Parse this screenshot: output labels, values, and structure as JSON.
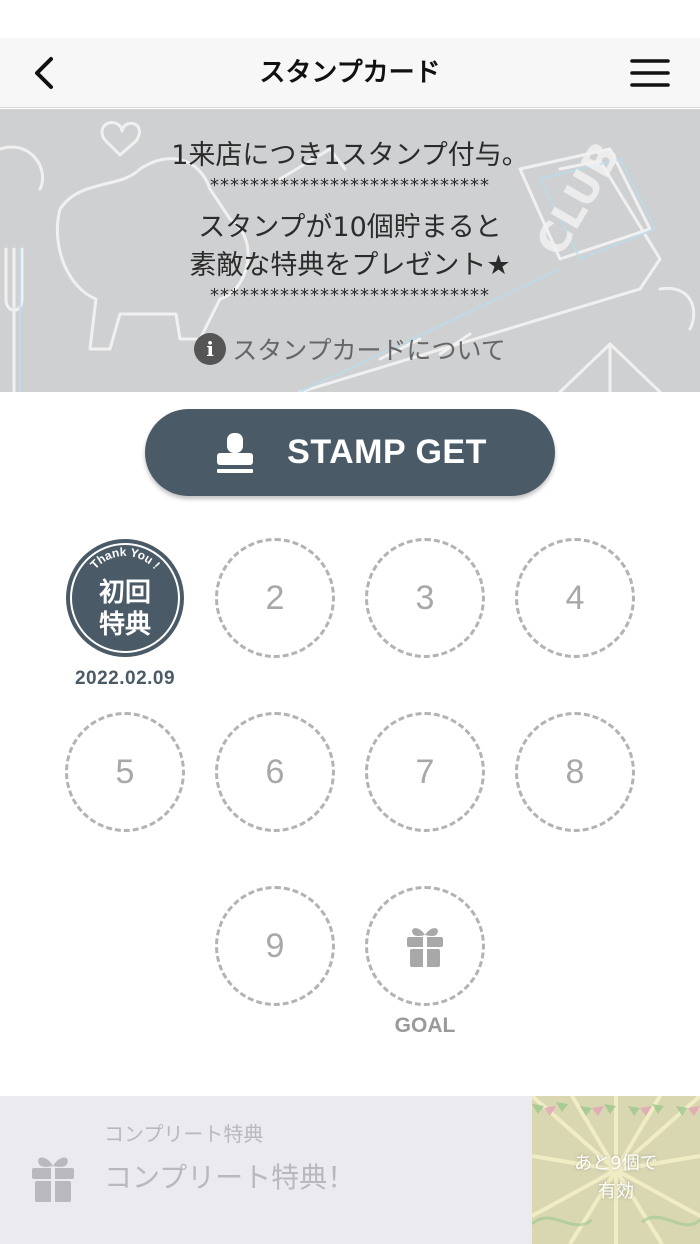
{
  "header": {
    "title": "スタンプカード",
    "back_icon": "chevron-left-icon",
    "menu_icon": "hamburger-menu-icon"
  },
  "banner": {
    "line1": "1来店につき1スタンプ付与。",
    "stars": "****************************",
    "line2": "スタンプが10個貯まると",
    "line3": "素敵な特典をプレゼント★",
    "about_label": "スタンプカードについて",
    "info_icon": "info-icon"
  },
  "stamp_button": {
    "label": "STAMP GET",
    "icon": "stamp-icon"
  },
  "stamps": {
    "first": {
      "arc_text": "Thank You !",
      "line1": "初回",
      "line2": "特典",
      "date": "2022.02.09"
    },
    "slots": [
      "2",
      "3",
      "4",
      "5",
      "6",
      "7",
      "8",
      "9"
    ],
    "goal_label": "GOAL",
    "goal_icon": "gift-icon"
  },
  "complete": {
    "subtitle": "コンプリート特典",
    "title": "コンプリート特典！",
    "remaining_line1": "あと9個で",
    "remaining_line2": "有効"
  },
  "colors": {
    "accent": "#4a5a67",
    "slot_border": "#b3b3b3",
    "banner_bg": "#cfd0d2"
  }
}
